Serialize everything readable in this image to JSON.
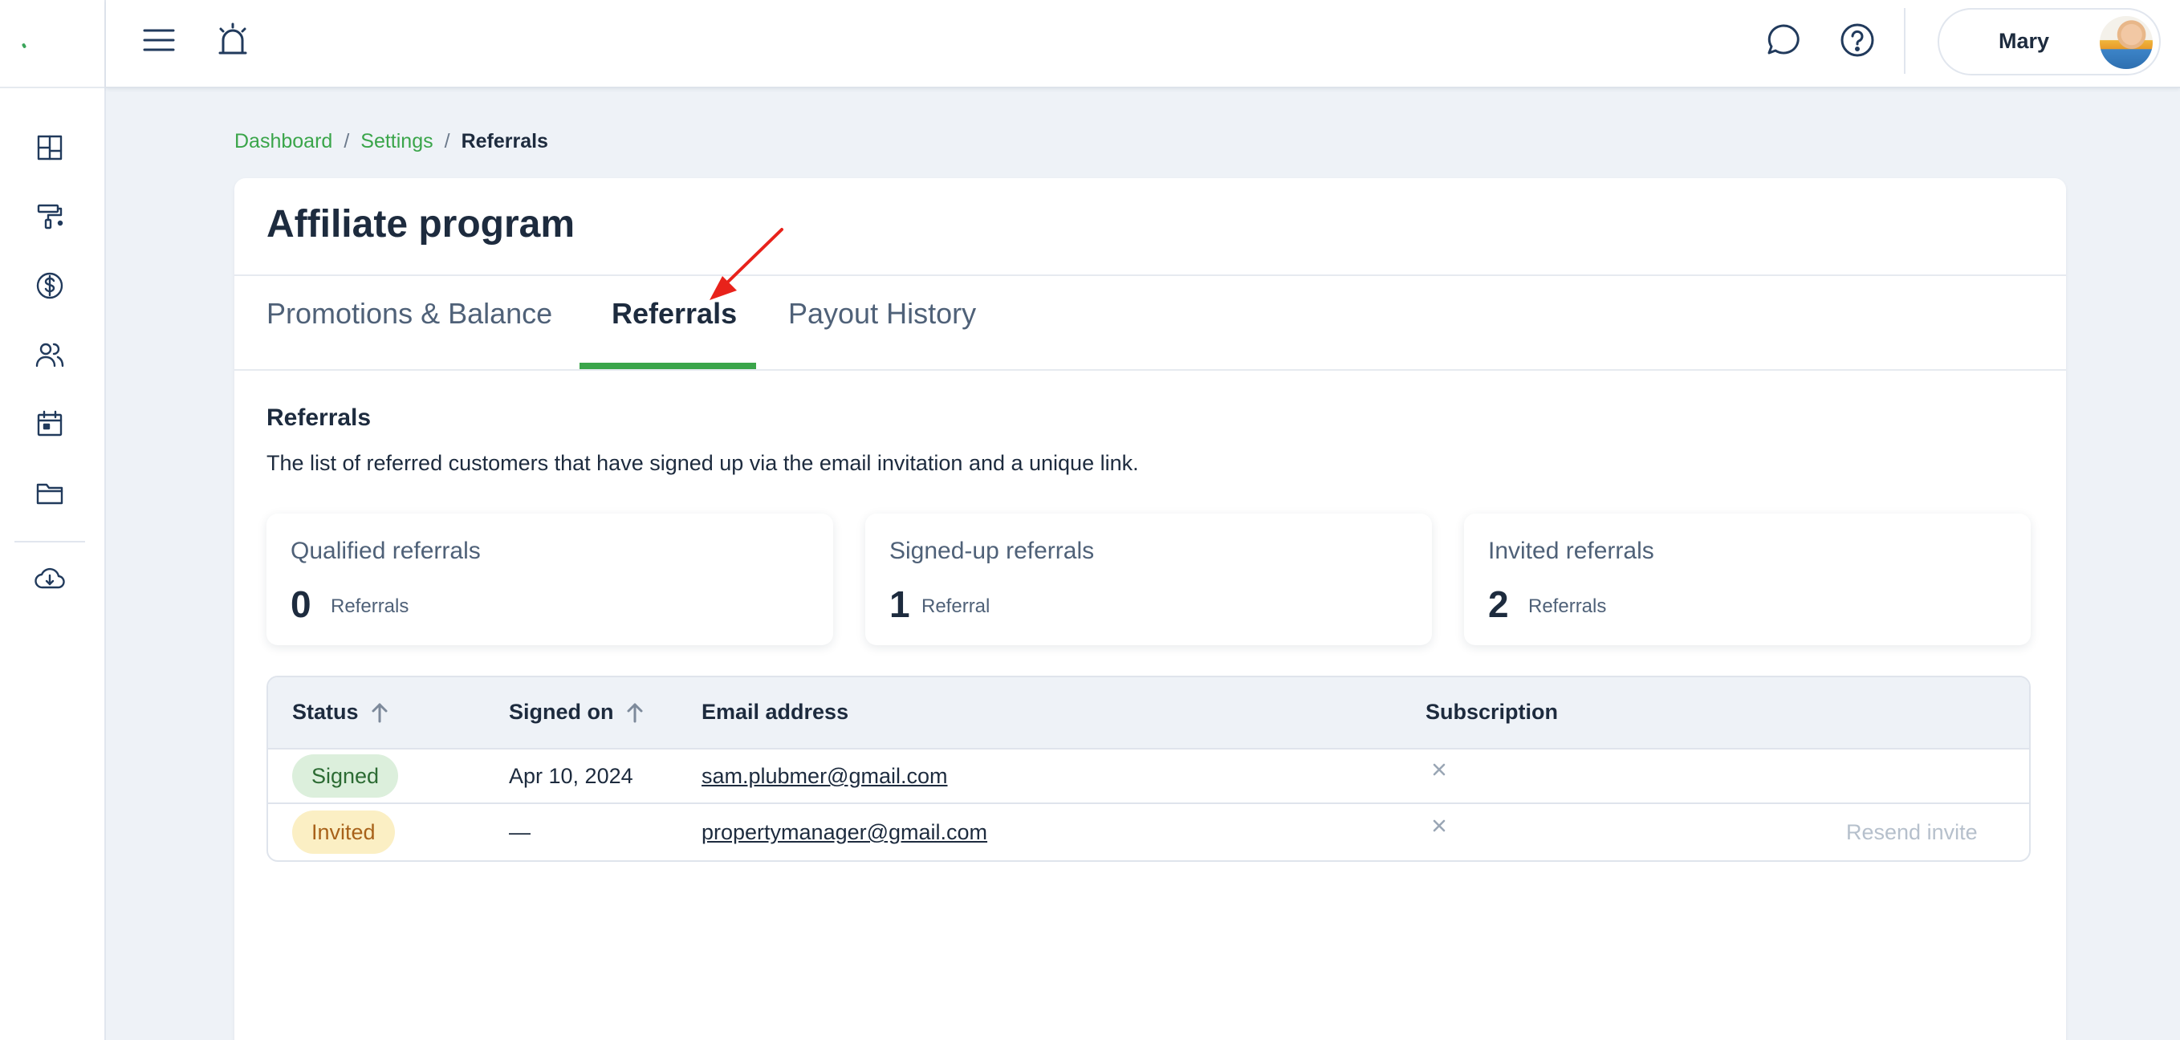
{
  "topbar": {
    "user_name": "Mary"
  },
  "breadcrumb": {
    "items": [
      "Dashboard",
      "Settings"
    ],
    "separator": "/",
    "current": "Referrals"
  },
  "page": {
    "title": "Affiliate program",
    "tabs": [
      {
        "label": "Promotions & Balance",
        "active": false
      },
      {
        "label": "Referrals",
        "active": true
      },
      {
        "label": "Payout History",
        "active": false
      }
    ]
  },
  "section": {
    "title": "Referrals",
    "description": "The list of referred customers that have signed up via the email invitation and a unique link."
  },
  "stats": [
    {
      "label": "Qualified referrals",
      "value": "0",
      "unit": "Referrals"
    },
    {
      "label": "Signed-up referrals",
      "value": "1",
      "unit": "Referral"
    },
    {
      "label": "Invited referrals",
      "value": "2",
      "unit": "Referrals"
    }
  ],
  "table": {
    "columns": [
      "Status",
      "Signed on",
      "Email address",
      "Subscription"
    ],
    "rows": [
      {
        "status": "Signed",
        "signed_on": "Apr 10, 2024",
        "email": "sam.plubmer@gmail.com",
        "subscription": "none",
        "action": ""
      },
      {
        "status": "Invited",
        "signed_on": "—",
        "email": "propertymanager@gmail.com",
        "subscription": "none",
        "action": "Resend invite"
      }
    ]
  },
  "colors": {
    "accent_green": "#3aa54a",
    "annotation_red": "#e8221b",
    "signed_badge_bg": "#dcefdc",
    "invited_badge_bg": "#fbefc4"
  },
  "icons": {
    "sidebar": [
      "dashboard-icon",
      "paint-roller-icon",
      "dollar-icon",
      "users-icon",
      "calendar-icon",
      "folder-icon",
      "cloud-download-icon"
    ],
    "topbar": [
      "menu-icon",
      "alarm-icon",
      "chat-icon",
      "help-icon"
    ]
  }
}
